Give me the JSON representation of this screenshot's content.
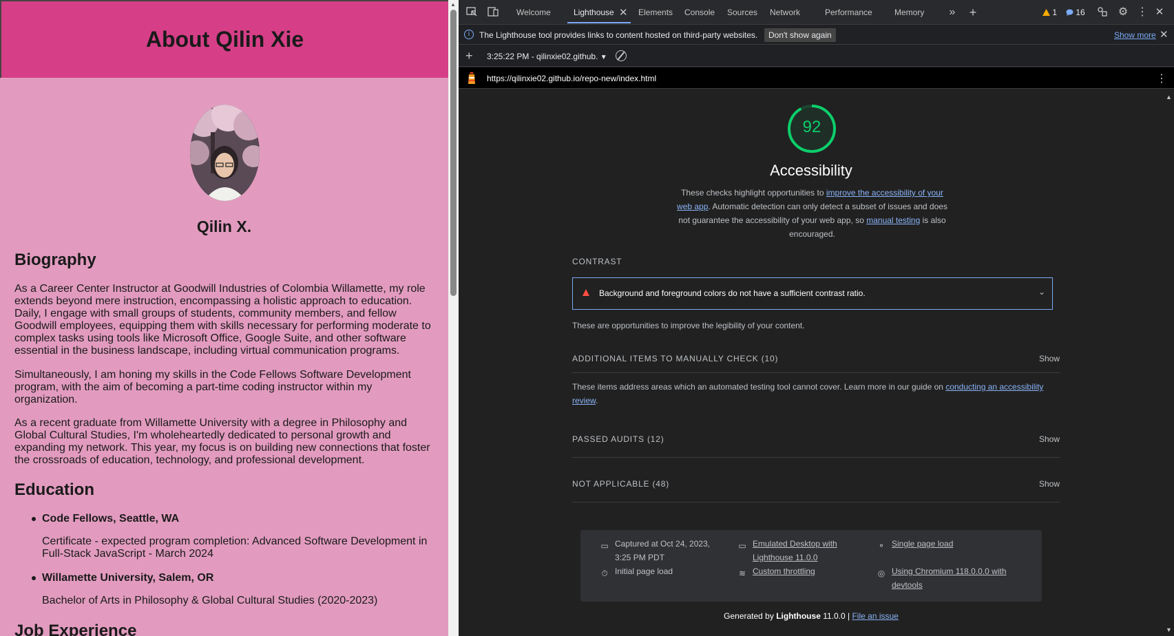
{
  "page": {
    "header_title": "About Qilin Xie",
    "name": "Qilin X.",
    "biography_heading": "Biography",
    "bio_paragraphs": [
      "As a Career Center Instructor at Goodwill Industries of Colombia Willamette, my role extends beyond mere instruction, encompassing a holistic approach to education. Daily, I engage with small groups of students, community members, and fellow Goodwill employees, equipping them with skills necessary for performing moderate to complex tasks using tools like Microsoft Office, Google Suite, and other software essential in the business landscape, including virtual communication programs.",
      "Simultaneously, I am honing my skills in the Code Fellows Software Development program, with the aim of becoming a part-time coding instructor within my organization.",
      "As a recent graduate from Willamette University with a degree in Philosophy and Global Cultural Studies, I'm wholeheartedly dedicated to personal growth and expanding my network. This year, my focus is on building new connections that foster the crossroads of education, technology, and professional development."
    ],
    "education_heading": "Education",
    "education": [
      {
        "school": "Code Fellows, Seattle, WA",
        "detail": "Certificate - expected program completion: Advanced Software Development in Full-Stack JavaScript - March 2024"
      },
      {
        "school": "Willamette University, Salem, OR",
        "detail": "Bachelor of Arts in Philosophy & Global Cultural Studies (2020-2023)"
      }
    ],
    "job_heading": "Job Experience"
  },
  "devtools": {
    "tabs": [
      "Welcome",
      "Lighthouse",
      "Elements",
      "Console",
      "Sources",
      "Network",
      "Performance",
      "Memory"
    ],
    "active_tab": "Lighthouse",
    "warnings_count": "1",
    "messages_count": "16",
    "infobar": {
      "message": "The Lighthouse tool provides links to content hosted on third-party websites.",
      "dont_show": "Don't show again",
      "show_more": "Show more"
    },
    "report_select": "3:25:22 PM - qilinxie02.github.",
    "url": "https://qilinxie02.github.io/repo-new/index.html"
  },
  "report": {
    "score": 92,
    "score_color": "#0cce6b",
    "category_title": "Accessibility",
    "desc_part1": "These checks highlight opportunities to ",
    "desc_link1": "improve the accessibility of your web app",
    "desc_part2": ". Automatic detection can only detect a subset of issues and does not guarantee the accessibility of your web app, so ",
    "desc_link2": "manual testing",
    "desc_part3": " is also encouraged.",
    "contrast_title": "CONTRAST",
    "contrast_audit": "Background and foreground colors do not have a sufficient contrast ratio.",
    "contrast_desc": "These are opportunities to improve the legibility of your content.",
    "manual_title": "ADDITIONAL ITEMS TO MANUALLY CHECK (10)",
    "manual_desc": "These items address areas which an automated testing tool cannot cover. Learn more in our guide on ",
    "manual_link": "conducting an accessibility review",
    "passed_title": "PASSED AUDITS (12)",
    "na_title": "NOT APPLICABLE (48)",
    "show_label": "Show",
    "meta": {
      "captured": "Captured at Oct 24, 2023, 3:25 PM PDT",
      "initial_load": "Initial page load",
      "emulated": "Emulated Desktop with Lighthouse 11.0.0",
      "throttling": "Custom throttling",
      "single_page": "Single page load",
      "chromium": "Using Chromium 118.0.0.0 with devtools"
    },
    "generated_prefix": "Generated by ",
    "generated_tool": "Lighthouse",
    "generated_version": " 11.0.0 | ",
    "file_issue": "File an issue"
  }
}
